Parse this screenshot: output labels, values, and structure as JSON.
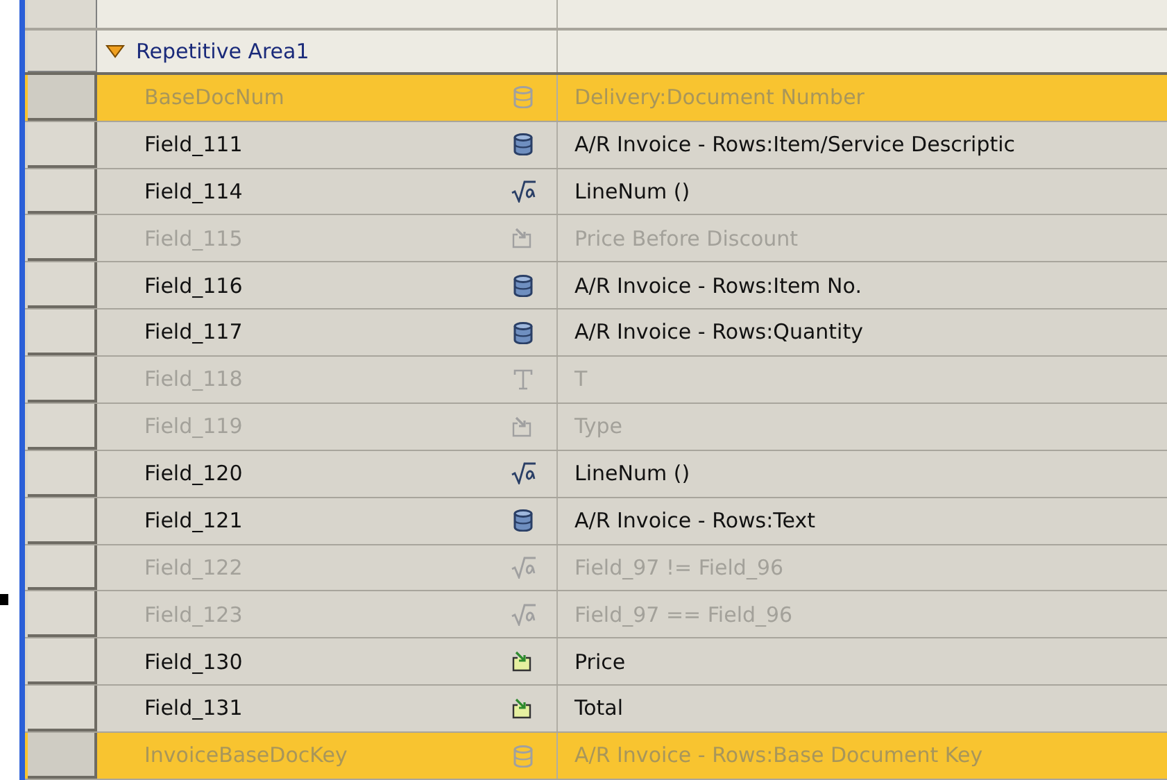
{
  "group": {
    "label": "Repetitive Area1",
    "expanded": true
  },
  "rows": [
    {
      "name": "BaseDocNum",
      "kind": "database",
      "description": "Delivery:Document Number",
      "selected": true,
      "disabled": true
    },
    {
      "name": "Field_111",
      "kind": "database",
      "description": "A/R Invoice - Rows:Item/Service Descriptic",
      "selected": false,
      "disabled": false
    },
    {
      "name": "Field_114",
      "kind": "formula",
      "description": "LineNum ()",
      "selected": false,
      "disabled": false
    },
    {
      "name": "Field_115",
      "kind": "link",
      "description": "Price Before Discount",
      "selected": false,
      "disabled": true
    },
    {
      "name": "Field_116",
      "kind": "database",
      "description": "A/R Invoice - Rows:Item No.",
      "selected": false,
      "disabled": false
    },
    {
      "name": "Field_117",
      "kind": "database",
      "description": "A/R Invoice - Rows:Quantity",
      "selected": false,
      "disabled": false
    },
    {
      "name": "Field_118",
      "kind": "text",
      "description": "T",
      "selected": false,
      "disabled": true
    },
    {
      "name": "Field_119",
      "kind": "link",
      "description": "Type",
      "selected": false,
      "disabled": true
    },
    {
      "name": "Field_120",
      "kind": "formula",
      "description": "LineNum ()",
      "selected": false,
      "disabled": false
    },
    {
      "name": "Field_121",
      "kind": "database",
      "description": "A/R Invoice - Rows:Text",
      "selected": false,
      "disabled": false
    },
    {
      "name": "Field_122",
      "kind": "formula",
      "description": "Field_97 != Field_96",
      "selected": false,
      "disabled": true
    },
    {
      "name": "Field_123",
      "kind": "formula",
      "description": "Field_97 == Field_96",
      "selected": false,
      "disabled": true
    },
    {
      "name": "Field_130",
      "kind": "link",
      "description": "Price",
      "selected": false,
      "disabled": false
    },
    {
      "name": "Field_131",
      "kind": "link",
      "description": "Total",
      "selected": false,
      "disabled": false
    },
    {
      "name": "InvoiceBaseDocKey",
      "kind": "database",
      "description": "A/R Invoice - Rows:Base Document Key",
      "selected": true,
      "disabled": true
    }
  ]
}
